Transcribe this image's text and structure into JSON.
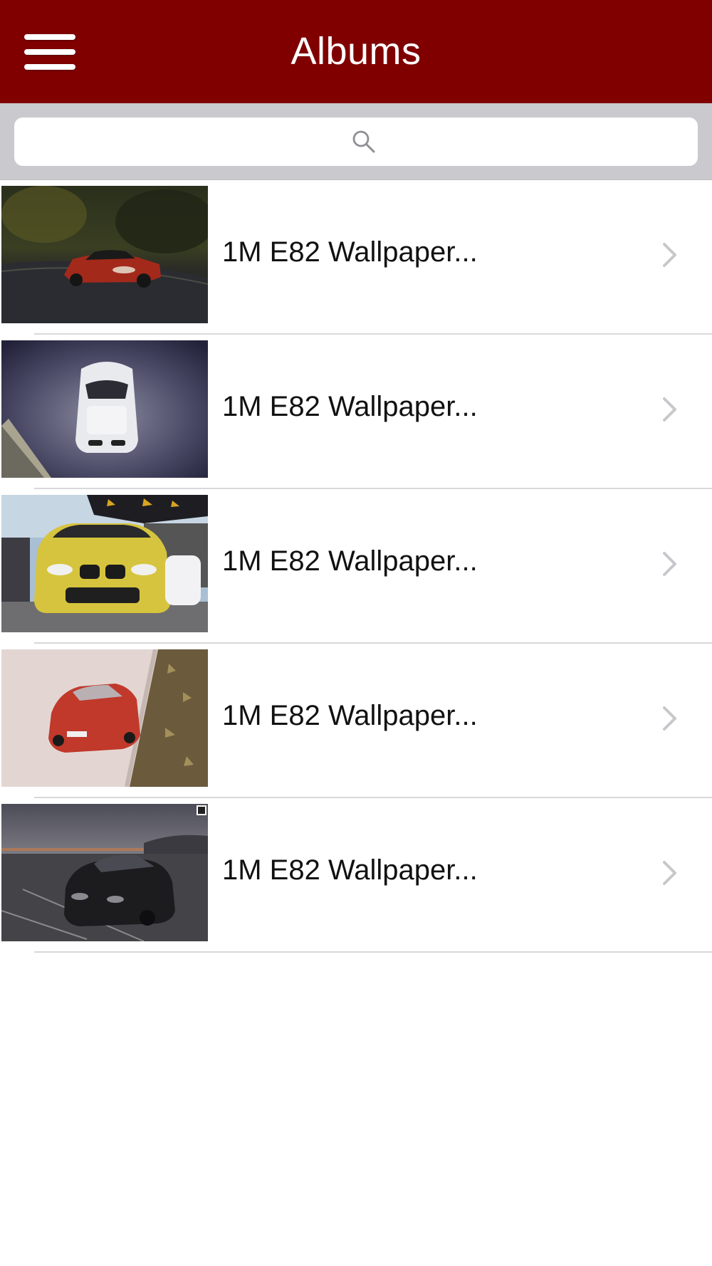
{
  "header": {
    "title": "Albums",
    "menu_icon": "hamburger-menu-icon",
    "background_color": "#800000"
  },
  "search": {
    "placeholder": "",
    "icon": "search-icon",
    "bar_color": "#c9c9ce"
  },
  "albums": [
    {
      "label": "1M E82 Wallpaper...",
      "thumbnail": "red car on forest road",
      "chevron": "chevron-right-icon"
    },
    {
      "label": "1M E82 Wallpaper...",
      "thumbnail": "white car top view on dark road",
      "chevron": "chevron-right-icon"
    },
    {
      "label": "1M E82 Wallpaper...",
      "thumbnail": "yellow car at event",
      "chevron": "chevron-right-icon"
    },
    {
      "label": "1M E82 Wallpaper...",
      "thumbnail": "red car on pavement",
      "chevron": "chevron-right-icon"
    },
    {
      "label": "1M E82 Wallpaper...",
      "thumbnail": "black car on lot at dusk",
      "chevron": "chevron-right-icon"
    }
  ]
}
